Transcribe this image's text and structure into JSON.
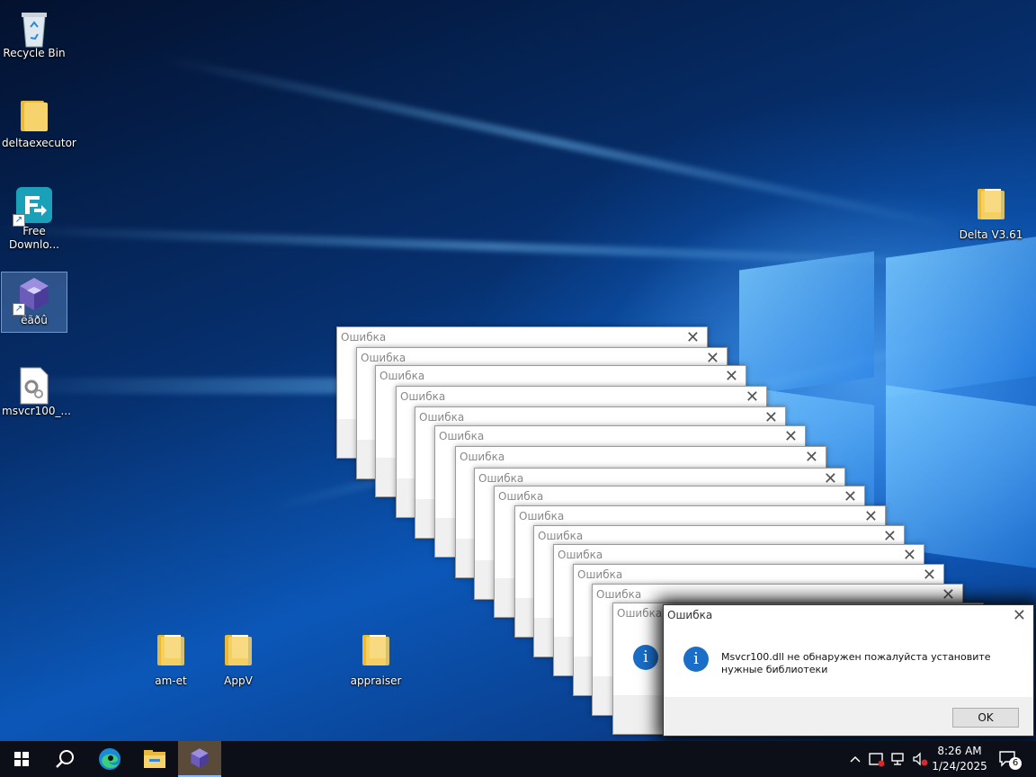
{
  "desktop_icons": [
    {
      "label": "Recycle Bin",
      "icon": "recycle-bin-icon"
    },
    {
      "label": "deltaexecutor",
      "icon": "folder-icon"
    },
    {
      "label": "Free\nDownlo...",
      "icon": "free-download-manager-icon"
    },
    {
      "label": "ëãðû",
      "icon": "game-cube-icon"
    },
    {
      "label": "msvcr100_...",
      "icon": "config-file-icon"
    },
    {
      "label": "Delta V3.61",
      "icon": "folder-icon"
    },
    {
      "label": "am-et",
      "icon": "folder-icon"
    },
    {
      "label": "AppV",
      "icon": "folder-icon"
    },
    {
      "label": "appraiser",
      "icon": "folder-icon"
    }
  ],
  "dialog": {
    "title": "Ошибка",
    "message": "Msvcr100.dll не обнаружен пожалуйста установите нужные библиотеки",
    "ok_label": "OK",
    "close_glyph": "✕",
    "info_glyph": "i"
  },
  "taskbar": {
    "items": [
      "start-icon",
      "search-icon",
      "edge-icon",
      "file-explorer-icon",
      "game-cube-icon"
    ],
    "tray": {
      "chevron": "^",
      "time": "8:26 AM",
      "date": "1/24/2025",
      "notification_count": "6"
    }
  },
  "colors": {
    "accent": "#1a6ec8",
    "taskbar": "#0c0f18"
  }
}
